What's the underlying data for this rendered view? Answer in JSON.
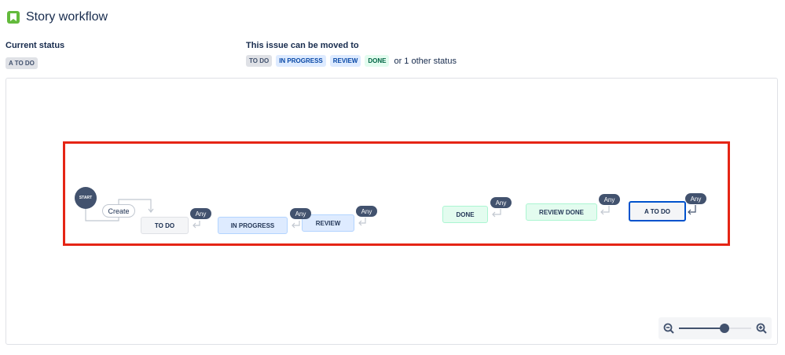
{
  "header": {
    "title": "Story workflow",
    "icon": "story-icon",
    "icon_color": "#63ba3c"
  },
  "current_status": {
    "heading": "Current status",
    "value": "A TO DO"
  },
  "transitions": {
    "heading": "This issue can be moved to",
    "targets": [
      {
        "label": "TO DO",
        "tone": "grey"
      },
      {
        "label": "IN PROGRESS",
        "tone": "blue"
      },
      {
        "label": "REVIEW",
        "tone": "blue"
      },
      {
        "label": "DONE",
        "tone": "green"
      }
    ],
    "other_text": "or 1 other status"
  },
  "diagram": {
    "start_label": "START",
    "create_label": "Create",
    "any_label": "Any",
    "nodes": [
      {
        "label": "TO DO",
        "tone": "grey"
      },
      {
        "label": "IN PROGRESS",
        "tone": "blue"
      },
      {
        "label": "REVIEW",
        "tone": "blue"
      },
      {
        "label": "DONE",
        "tone": "green"
      },
      {
        "label": "REVIEW DONE",
        "tone": "green"
      },
      {
        "label": "A TO DO",
        "tone": "selected"
      }
    ],
    "highlight_color": "#e52515"
  },
  "zoom": {
    "level": 0.63,
    "zoom_out_icon": "zoom-out-icon",
    "zoom_in_icon": "zoom-in-icon"
  }
}
